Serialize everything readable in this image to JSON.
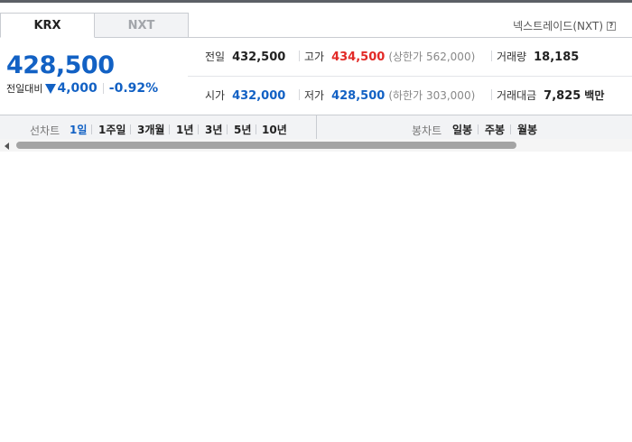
{
  "market_tabs": [
    {
      "label": "KRX",
      "active": true
    },
    {
      "label": "NXT",
      "active": false
    }
  ],
  "nxt_link": {
    "label": "넥스트레이드(NXT)",
    "help": "?"
  },
  "quote": {
    "price": "428,500",
    "change_label": "전일대비",
    "change_value": "4,000",
    "change_direction": "down",
    "change_pct": "-0.92%"
  },
  "stats": {
    "prev": {
      "label": "전일",
      "value": "432,500"
    },
    "high": {
      "label": "고가",
      "value": "434,500",
      "limit_label": "상한가",
      "limit_value": "562,000"
    },
    "volume": {
      "label": "거래량",
      "value": "18,185"
    },
    "open": {
      "label": "시가",
      "value": "432,000"
    },
    "low": {
      "label": "저가",
      "value": "428,500",
      "limit_label": "하한가",
      "limit_value": "303,000"
    },
    "amount": {
      "label": "거래대금",
      "value": "7,825",
      "unit": "백만"
    }
  },
  "line_chart": {
    "label": "선차트",
    "options": [
      "1일",
      "1주일",
      "3개월",
      "1년",
      "3년",
      "5년",
      "10년"
    ],
    "selected": "1일"
  },
  "candle_chart": {
    "label": "봉차트",
    "options": [
      "일봉",
      "주봉",
      "월봉"
    ]
  },
  "colors": {
    "up": "#e22926",
    "down": "#1261c4",
    "neutral": "#222222"
  },
  "scrollbar": {
    "icon": "scroll-left-arrow-icon"
  }
}
